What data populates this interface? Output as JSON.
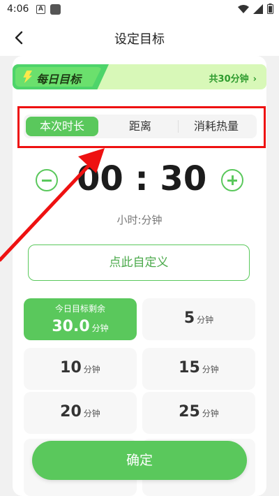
{
  "status_bar": {
    "time": "4:06",
    "a_icon": "A"
  },
  "header": {
    "title": "设定目标"
  },
  "banner": {
    "label": "每日目标",
    "total": "共30分钟"
  },
  "tabs": [
    {
      "label": "本次时长",
      "active": true
    },
    {
      "label": "距离",
      "active": false
    },
    {
      "label": "消耗热量",
      "active": false
    }
  ],
  "timer": {
    "value": "00 : 30",
    "unit_hint": "小时:分钟"
  },
  "custom_button": "点此自定义",
  "options": {
    "today_remaining": {
      "caption": "今日目标剩余",
      "value": "30.0",
      "unit": "分钟"
    },
    "items": [
      {
        "value": "5",
        "unit": "分钟"
      },
      {
        "value": "10",
        "unit": "分钟"
      },
      {
        "value": "15",
        "unit": "分钟"
      },
      {
        "value": "20",
        "unit": "分钟"
      },
      {
        "value": "25",
        "unit": "分钟"
      }
    ]
  },
  "confirm_button": "确定",
  "colors": {
    "accent": "#5ac85c",
    "banner_bg": "#d8f8b8",
    "annotation": "#e11111"
  }
}
